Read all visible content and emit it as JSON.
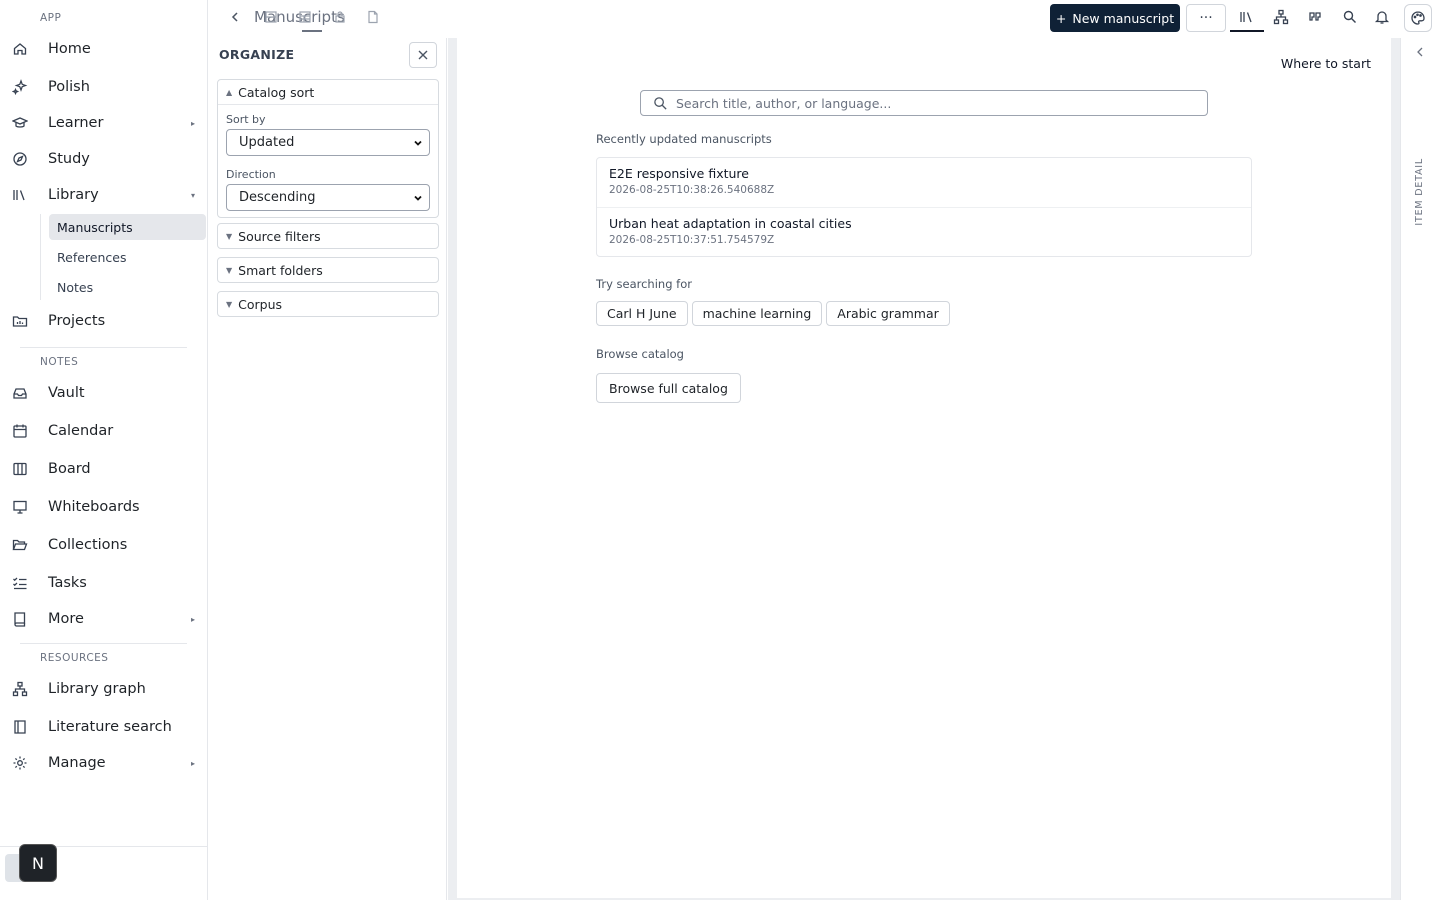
{
  "sidebar": {
    "sections": {
      "app": "APP",
      "notes": "NOTES",
      "resources": "RESOURCES"
    },
    "items": {
      "home": "Home",
      "polish": "Polish",
      "learner": "Learner",
      "study": "Study",
      "library": "Library",
      "projects": "Projects",
      "vault": "Vault",
      "calendar": "Calendar",
      "board": "Board",
      "whiteboards": "Whiteboards",
      "collections": "Collections",
      "tasks": "Tasks",
      "more": "More",
      "library_graph": "Library graph",
      "literature_search": "Literature search",
      "manage": "Manage"
    },
    "library_sub": {
      "manuscripts": "Manuscripts",
      "references": "References",
      "notes": "Notes"
    },
    "workspace_badge": "N"
  },
  "topbar": {
    "title": "Manuscripts",
    "new_button": "New manuscript",
    "more_button": "···",
    "tool_icons": [
      "library-icon",
      "graph-icon",
      "quote-icon",
      "search-icon",
      "bell-icon",
      "palette-icon"
    ]
  },
  "organize": {
    "title": "ORGANIZE",
    "catalog_sort": "Catalog sort",
    "sort_by_label": "Sort by",
    "sort_by_value": "Updated",
    "direction_label": "Direction",
    "direction_value": "Descending",
    "source_filters": "Source filters",
    "smart_folders": "Smart folders",
    "corpus": "Corpus"
  },
  "main": {
    "where_to_start": "Where to start",
    "search_placeholder": "Search title, author, or language...",
    "recent_heading": "Recently updated manuscripts",
    "recent": [
      {
        "title": "E2E responsive fixture",
        "date": "2026-08-25T10:38:26.540688Z"
      },
      {
        "title": "Urban heat adaptation in coastal cities",
        "date": "2026-08-25T10:37:51.754579Z"
      }
    ],
    "try_heading": "Try searching for",
    "suggestions": [
      "Carl H June",
      "machine learning",
      "Arabic grammar"
    ],
    "browse_heading": "Browse catalog",
    "browse_button": "Browse full catalog"
  },
  "detail": {
    "label": "ITEM DETAIL"
  },
  "colors": {
    "primary": "#0f2136",
    "active_nav_bg": "#e5e7eb",
    "border": "#d1d5db"
  }
}
